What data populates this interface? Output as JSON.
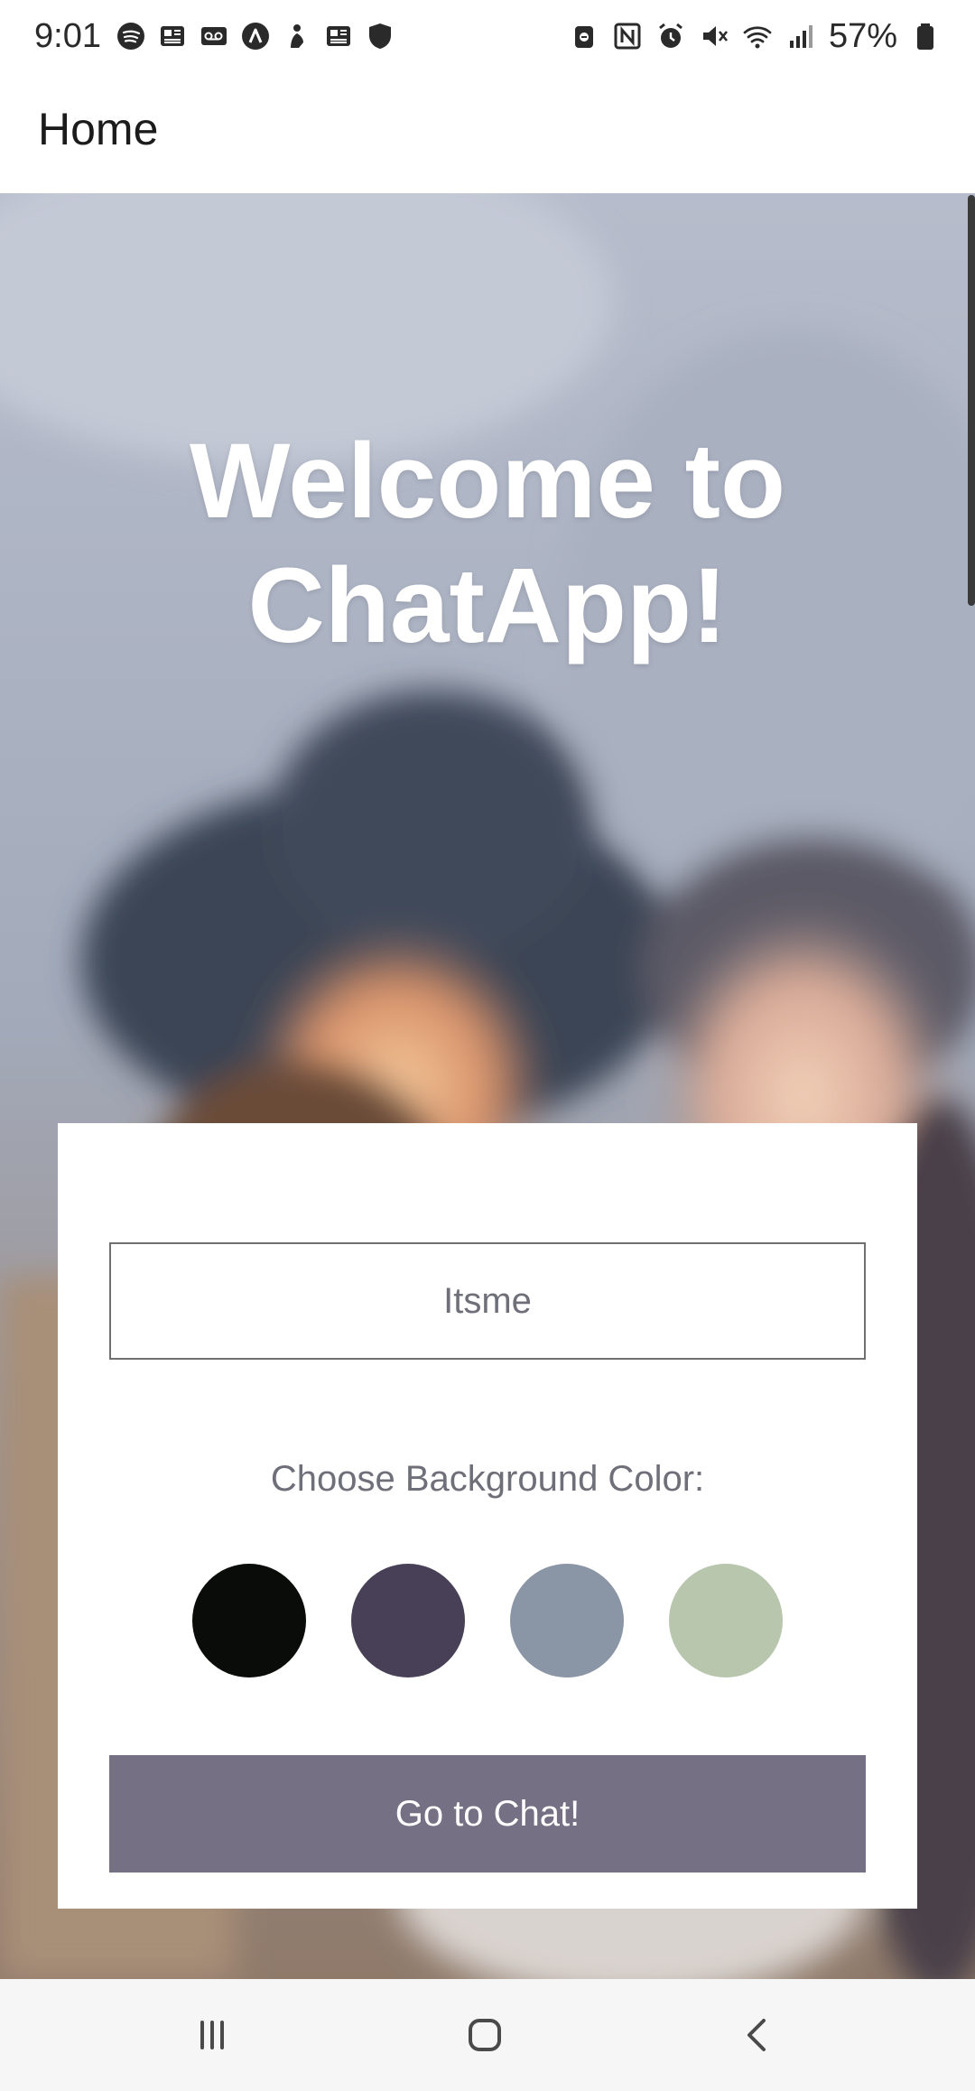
{
  "status_bar": {
    "time": "9:01",
    "battery_percent": "57%",
    "left_icons": [
      "spotify-icon",
      "news-icon",
      "voicemail-icon",
      "arc-icon",
      "hand-icon",
      "news-icon",
      "shield-icon"
    ],
    "right_icons": [
      "dnd-icon",
      "nfc-icon",
      "alarm-icon",
      "mute-icon",
      "wifi-icon",
      "signal-icon",
      "battery-icon"
    ]
  },
  "app_bar": {
    "title": "Home"
  },
  "hero": {
    "line1": "Welcome to",
    "line2": "ChatApp!"
  },
  "form": {
    "name_input": {
      "placeholder": "Itsme",
      "value": ""
    },
    "color_label": "Choose Background Color:",
    "colors": [
      "#090c08",
      "#474056",
      "#8a95a5",
      "#b9c6ae"
    ],
    "submit_label": "Go to Chat!",
    "submit_color": "#757083"
  },
  "nav_bar": {
    "buttons": [
      "recent-apps-icon",
      "home-icon",
      "back-icon"
    ]
  }
}
